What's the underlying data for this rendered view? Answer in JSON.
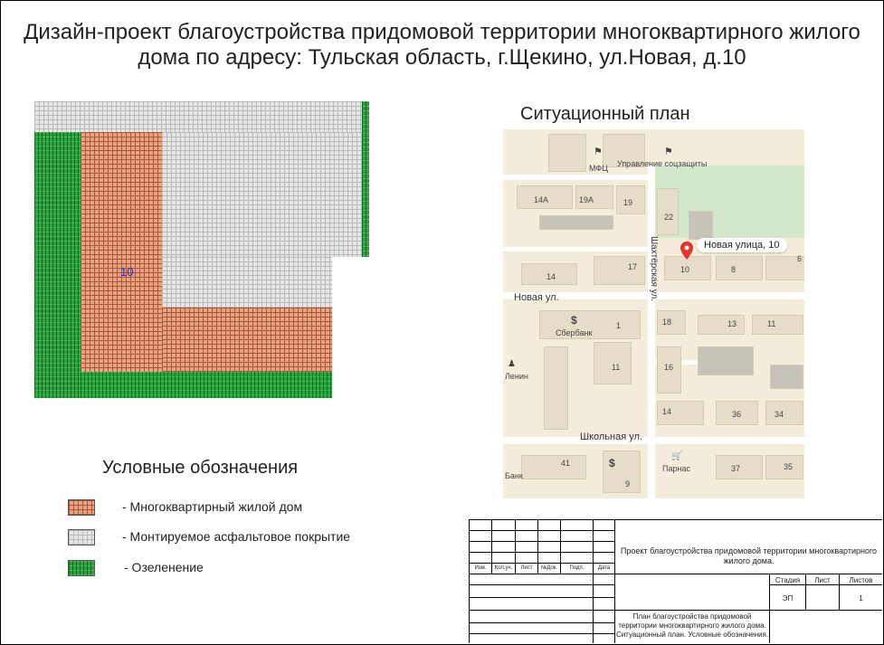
{
  "title": {
    "line1": "Дизайн-проект благоустройства придомовой территории многоквартирного жилого",
    "line2": "дома по адресу: Тульская область, г.Щекино, ул.Новая, д.10"
  },
  "plan": {
    "building_label": "10"
  },
  "situational_plan": {
    "title": "Ситуационный план",
    "marker_label": "Новая улица, 10",
    "labels": {
      "mfc": "МФЦ",
      "uprav": "Управление соцзащиты",
      "b14a": "14А",
      "b19a": "19А",
      "b19": "19",
      "b22": "22",
      "b14": "14",
      "b17": "17",
      "b10": "10",
      "b8": "8",
      "b6": "6",
      "novaya": "Новая ул.",
      "shakhterskaya": "Шахтёрская ул.",
      "sberbank": "Сбербанк",
      "b1": "1",
      "b18": "18",
      "b13": "13",
      "b11a": "11",
      "b11b": "11",
      "b16": "16",
      "lenin": "Ленин",
      "b14b": "14",
      "b36": "36",
      "b34": "34",
      "shkolnaya": "Школьная ул.",
      "b41": "41",
      "bank": "Банк",
      "parnas": "Парнас",
      "b37": "37",
      "b35": "35",
      "b9": "9"
    }
  },
  "legend": {
    "title": "Условные обозначения",
    "items": [
      {
        "label": "- Многоквартирный жилой дом",
        "color": "#e8a37f"
      },
      {
        "label": "- Монтируемое асфальтовое покрытие",
        "color": "#e6e6e6"
      },
      {
        "label": "- Озеленение",
        "color": "#25a33a"
      }
    ]
  },
  "stamp": {
    "headers": [
      "Изм.",
      "Кол.уч.",
      "Лист",
      "№Док.",
      "Подп.",
      "Дата"
    ],
    "project_title": "Проект благоустройства придомовой территории многоквартирного жилого дома.",
    "sheet_title": "План благоустройства придомовой территории многоквартирного жилого дома. Ситуационный план. Условные обозначения.",
    "stage_label": "Стадия",
    "sheet_label": "Лист",
    "sheets_label": "Листов",
    "stage_value": "ЭП",
    "sheet_value": "",
    "sheets_value": "1"
  }
}
